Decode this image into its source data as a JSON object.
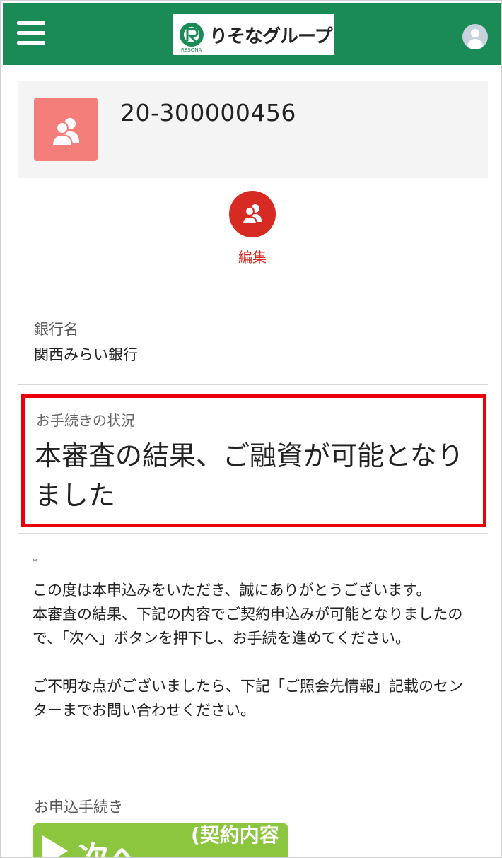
{
  "header": {
    "logo_text": "りそなグループ",
    "logo_sub": "RESONA"
  },
  "account": {
    "number": "20-300000456"
  },
  "edit": {
    "label": "編集"
  },
  "bank": {
    "label": "銀行名",
    "value": "関西みらい銀行"
  },
  "status": {
    "label": "お手続きの状況",
    "text": "本審査の結果、ご融資が可能となりました"
  },
  "message": {
    "asterisk": "*",
    "line1": "この度は本申込みをいただき、誠にありがとうございます。",
    "line2": "本審査の結果、下記の内容でご契約申込みが可能となりましたので、「次へ」ボタンを押下し、お手続を進めてください。",
    "line3": "ご不明な点がございましたら、下記「ご照会先情報」記載のセンターまでお問い合わせください。"
  },
  "procedure": {
    "label": "お申込手続き",
    "next_main": "次へ",
    "next_sub": "(契約内容"
  },
  "colors": {
    "brand_green": "#1a8a57",
    "accent_red": "#d72a22",
    "highlight_red": "#e8000b",
    "button_green": "#8cc63f",
    "account_icon": "#f47e79"
  }
}
